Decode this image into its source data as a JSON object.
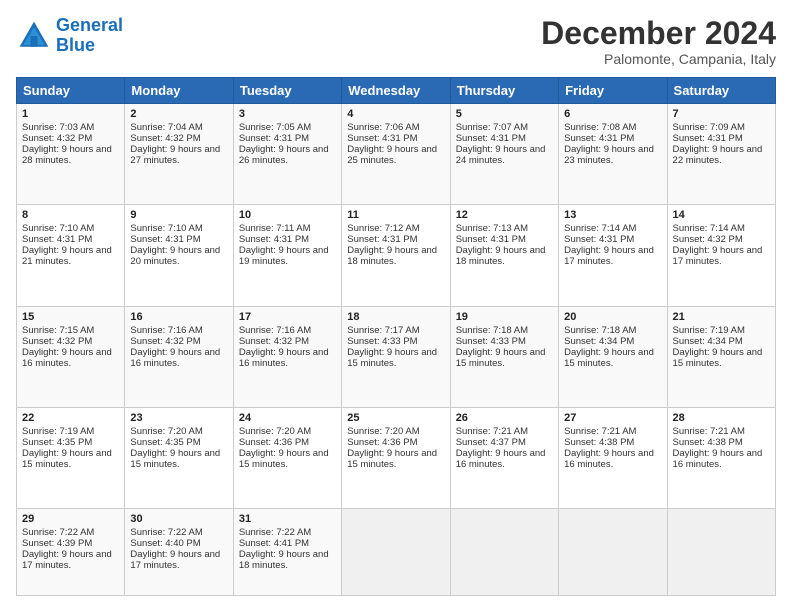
{
  "header": {
    "logo_line1": "General",
    "logo_line2": "Blue",
    "month": "December 2024",
    "location": "Palomonte, Campania, Italy"
  },
  "days_of_week": [
    "Sunday",
    "Monday",
    "Tuesday",
    "Wednesday",
    "Thursday",
    "Friday",
    "Saturday"
  ],
  "weeks": [
    [
      {
        "day": 1,
        "sunrise": "7:03 AM",
        "sunset": "4:32 PM",
        "daylight": "9 hours and 28 minutes."
      },
      {
        "day": 2,
        "sunrise": "7:04 AM",
        "sunset": "4:32 PM",
        "daylight": "9 hours and 27 minutes."
      },
      {
        "day": 3,
        "sunrise": "7:05 AM",
        "sunset": "4:31 PM",
        "daylight": "9 hours and 26 minutes."
      },
      {
        "day": 4,
        "sunrise": "7:06 AM",
        "sunset": "4:31 PM",
        "daylight": "9 hours and 25 minutes."
      },
      {
        "day": 5,
        "sunrise": "7:07 AM",
        "sunset": "4:31 PM",
        "daylight": "9 hours and 24 minutes."
      },
      {
        "day": 6,
        "sunrise": "7:08 AM",
        "sunset": "4:31 PM",
        "daylight": "9 hours and 23 minutes."
      },
      {
        "day": 7,
        "sunrise": "7:09 AM",
        "sunset": "4:31 PM",
        "daylight": "9 hours and 22 minutes."
      }
    ],
    [
      {
        "day": 8,
        "sunrise": "7:10 AM",
        "sunset": "4:31 PM",
        "daylight": "9 hours and 21 minutes."
      },
      {
        "day": 9,
        "sunrise": "7:10 AM",
        "sunset": "4:31 PM",
        "daylight": "9 hours and 20 minutes."
      },
      {
        "day": 10,
        "sunrise": "7:11 AM",
        "sunset": "4:31 PM",
        "daylight": "9 hours and 19 minutes."
      },
      {
        "day": 11,
        "sunrise": "7:12 AM",
        "sunset": "4:31 PM",
        "daylight": "9 hours and 18 minutes."
      },
      {
        "day": 12,
        "sunrise": "7:13 AM",
        "sunset": "4:31 PM",
        "daylight": "9 hours and 18 minutes."
      },
      {
        "day": 13,
        "sunrise": "7:14 AM",
        "sunset": "4:31 PM",
        "daylight": "9 hours and 17 minutes."
      },
      {
        "day": 14,
        "sunrise": "7:14 AM",
        "sunset": "4:32 PM",
        "daylight": "9 hours and 17 minutes."
      }
    ],
    [
      {
        "day": 15,
        "sunrise": "7:15 AM",
        "sunset": "4:32 PM",
        "daylight": "9 hours and 16 minutes."
      },
      {
        "day": 16,
        "sunrise": "7:16 AM",
        "sunset": "4:32 PM",
        "daylight": "9 hours and 16 minutes."
      },
      {
        "day": 17,
        "sunrise": "7:16 AM",
        "sunset": "4:32 PM",
        "daylight": "9 hours and 16 minutes."
      },
      {
        "day": 18,
        "sunrise": "7:17 AM",
        "sunset": "4:33 PM",
        "daylight": "9 hours and 15 minutes."
      },
      {
        "day": 19,
        "sunrise": "7:18 AM",
        "sunset": "4:33 PM",
        "daylight": "9 hours and 15 minutes."
      },
      {
        "day": 20,
        "sunrise": "7:18 AM",
        "sunset": "4:34 PM",
        "daylight": "9 hours and 15 minutes."
      },
      {
        "day": 21,
        "sunrise": "7:19 AM",
        "sunset": "4:34 PM",
        "daylight": "9 hours and 15 minutes."
      }
    ],
    [
      {
        "day": 22,
        "sunrise": "7:19 AM",
        "sunset": "4:35 PM",
        "daylight": "9 hours and 15 minutes."
      },
      {
        "day": 23,
        "sunrise": "7:20 AM",
        "sunset": "4:35 PM",
        "daylight": "9 hours and 15 minutes."
      },
      {
        "day": 24,
        "sunrise": "7:20 AM",
        "sunset": "4:36 PM",
        "daylight": "9 hours and 15 minutes."
      },
      {
        "day": 25,
        "sunrise": "7:20 AM",
        "sunset": "4:36 PM",
        "daylight": "9 hours and 15 minutes."
      },
      {
        "day": 26,
        "sunrise": "7:21 AM",
        "sunset": "4:37 PM",
        "daylight": "9 hours and 16 minutes."
      },
      {
        "day": 27,
        "sunrise": "7:21 AM",
        "sunset": "4:38 PM",
        "daylight": "9 hours and 16 minutes."
      },
      {
        "day": 28,
        "sunrise": "7:21 AM",
        "sunset": "4:38 PM",
        "daylight": "9 hours and 16 minutes."
      }
    ],
    [
      {
        "day": 29,
        "sunrise": "7:22 AM",
        "sunset": "4:39 PM",
        "daylight": "9 hours and 17 minutes."
      },
      {
        "day": 30,
        "sunrise": "7:22 AM",
        "sunset": "4:40 PM",
        "daylight": "9 hours and 17 minutes."
      },
      {
        "day": 31,
        "sunrise": "7:22 AM",
        "sunset": "4:41 PM",
        "daylight": "9 hours and 18 minutes."
      },
      null,
      null,
      null,
      null
    ]
  ]
}
